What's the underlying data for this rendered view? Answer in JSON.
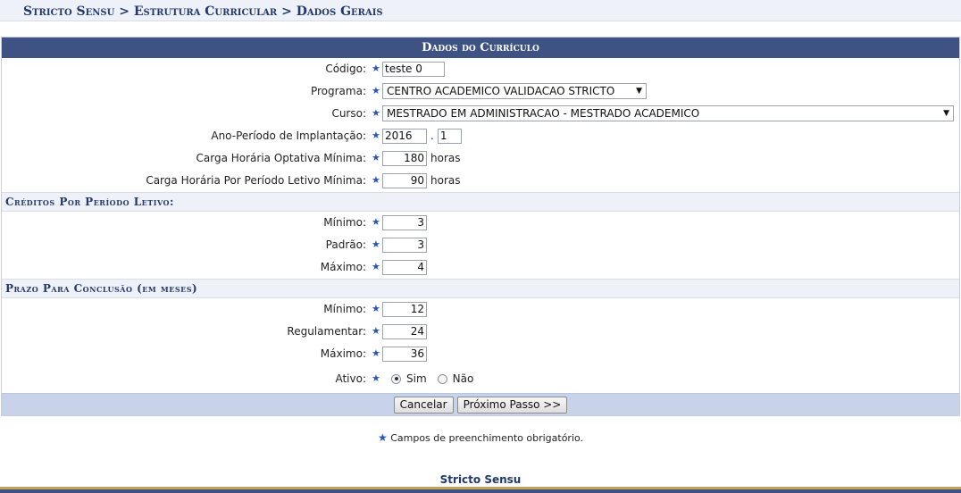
{
  "breadcrumb": "Stricto Sensu > Estrutura Curricular > Dados Gerais",
  "caption": "Dados do Currículo",
  "fields": {
    "codigo": {
      "label": "Código:",
      "value": "teste 0"
    },
    "programa": {
      "label": "Programa:",
      "value": "CENTRO ACADEMICO VALIDACAO STRICTO"
    },
    "curso": {
      "label": "Curso:",
      "value": "MESTRADO EM ADMINISTRACAO - MESTRADO ACADEMICO"
    },
    "ano_periodo": {
      "label": "Ano-Período de Implantação:",
      "ano": "2016",
      "sep": ".",
      "periodo": "1"
    },
    "ch_optativa": {
      "label": "Carga Horária Optativa Mínima:",
      "value": "180",
      "unit": "horas"
    },
    "ch_periodo": {
      "label": "Carga Horária Por Período Letivo Mínima:",
      "value": "90",
      "unit": "horas"
    }
  },
  "creditos": {
    "title": "Créditos Por Período Letivo:",
    "minimo": {
      "label": "Mínimo:",
      "value": "3"
    },
    "padrao": {
      "label": "Padrão:",
      "value": "3"
    },
    "maximo": {
      "label": "Máximo:",
      "value": "4"
    }
  },
  "prazo": {
    "title": "Prazo Para Conclusão (em meses)",
    "minimo": {
      "label": "Mínimo:",
      "value": "12"
    },
    "regulamentar": {
      "label": "Regulamentar:",
      "value": "24"
    },
    "maximo": {
      "label": "Máximo:",
      "value": "36"
    }
  },
  "ativo": {
    "label": "Ativo:",
    "sim": "Sim",
    "nao": "Não",
    "selected": "Sim"
  },
  "buttons": {
    "cancelar": "Cancelar",
    "proximo": "Próximo Passo >>"
  },
  "required_star": "★",
  "dropdown_arrow": "▼",
  "note": "Campos de preenchimento obrigatório.",
  "footer": "Stricto Sensu",
  "icons": {
    "required": "star-icon",
    "dropdown": "chevron-down-icon"
  },
  "colors": {
    "caption_bg": "#3e5283",
    "section_bg": "#eef2f8",
    "button_bar": "#c8d3ea",
    "star": "#2a55b8"
  }
}
